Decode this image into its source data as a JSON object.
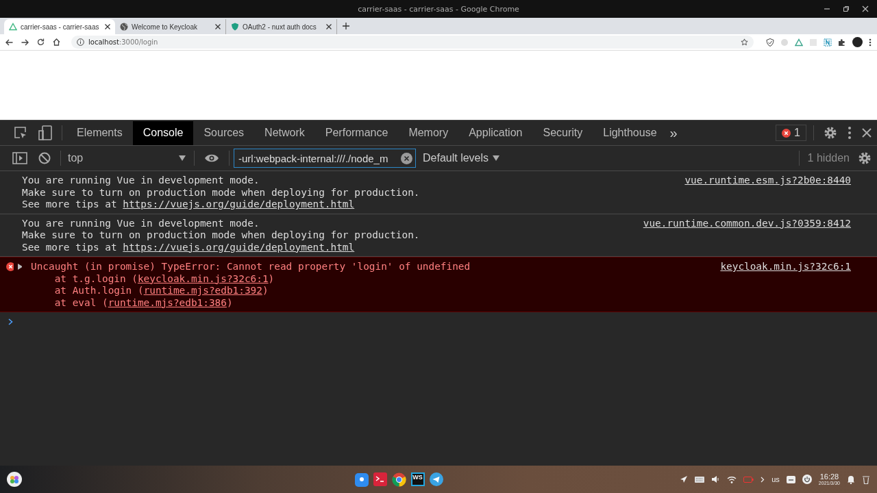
{
  "window": {
    "title": "carrier-saas - carrier-saas - Google Chrome"
  },
  "browser_tabs": [
    {
      "title": "carrier-saas - carrier-saas",
      "selected": true,
      "kind": "nuxt"
    },
    {
      "title": "Welcome to Keycloak",
      "selected": false,
      "kind": "globe"
    },
    {
      "title": "OAuth2 - nuxt auth docs",
      "selected": false,
      "kind": "shield"
    }
  ],
  "address_bar": {
    "host": "localhost",
    "path": ":3000/login"
  },
  "devtools": {
    "panels": [
      {
        "label": "Elements",
        "selected": false
      },
      {
        "label": "Console",
        "selected": true
      },
      {
        "label": "Sources",
        "selected": false
      },
      {
        "label": "Network",
        "selected": false
      },
      {
        "label": "Performance",
        "selected": false
      },
      {
        "label": "Memory",
        "selected": false
      },
      {
        "label": "Application",
        "selected": false
      },
      {
        "label": "Security",
        "selected": false
      },
      {
        "label": "Lighthouse",
        "selected": false
      }
    ],
    "more_panels": "»",
    "error_count": "1",
    "context": "top",
    "filter": "-url:webpack-internal:///./node_m",
    "levels": "Default levels",
    "hidden": "1 hidden",
    "messages": [
      {
        "kind": "info",
        "source": "vue.runtime.esm.js?2b0e:8440",
        "lines": [
          [
            {
              "text": "You are running Vue in development mode."
            }
          ],
          [
            {
              "text": "Make sure to turn on production mode when deploying for production."
            }
          ],
          [
            {
              "text": "See more tips at "
            },
            {
              "link": "https://vuejs.org/guide/deployment.html"
            }
          ]
        ]
      },
      {
        "kind": "info",
        "source": "vue.runtime.common.dev.js?0359:8412",
        "lines": [
          [
            {
              "text": "You are running Vue in development mode."
            }
          ],
          [
            {
              "text": "Make sure to turn on production mode when deploying for production."
            }
          ],
          [
            {
              "text": "See more tips at "
            },
            {
              "link": "https://vuejs.org/guide/deployment.html"
            }
          ]
        ]
      },
      {
        "kind": "error",
        "source": "keycloak.min.js?32c6:1",
        "lines": [
          [
            {
              "text": "Uncaught (in promise) TypeError: Cannot read property 'login' of undefined"
            }
          ],
          [
            {
              "text": "    at t.g.login ("
            },
            {
              "link": "keycloak.min.js?32c6:1"
            },
            {
              "text": ")"
            }
          ],
          [
            {
              "text": "    at Auth.login ("
            },
            {
              "link": "runtime.mjs?edb1:392"
            },
            {
              "text": ")"
            }
          ],
          [
            {
              "text": "    at eval ("
            },
            {
              "link": "runtime.mjs?edb1:386"
            },
            {
              "text": ")"
            }
          ]
        ]
      }
    ]
  },
  "taskbar": {
    "ide_label": "WS",
    "keyboard_layout": "us",
    "time": "16:28",
    "date": "2021/3/30"
  }
}
